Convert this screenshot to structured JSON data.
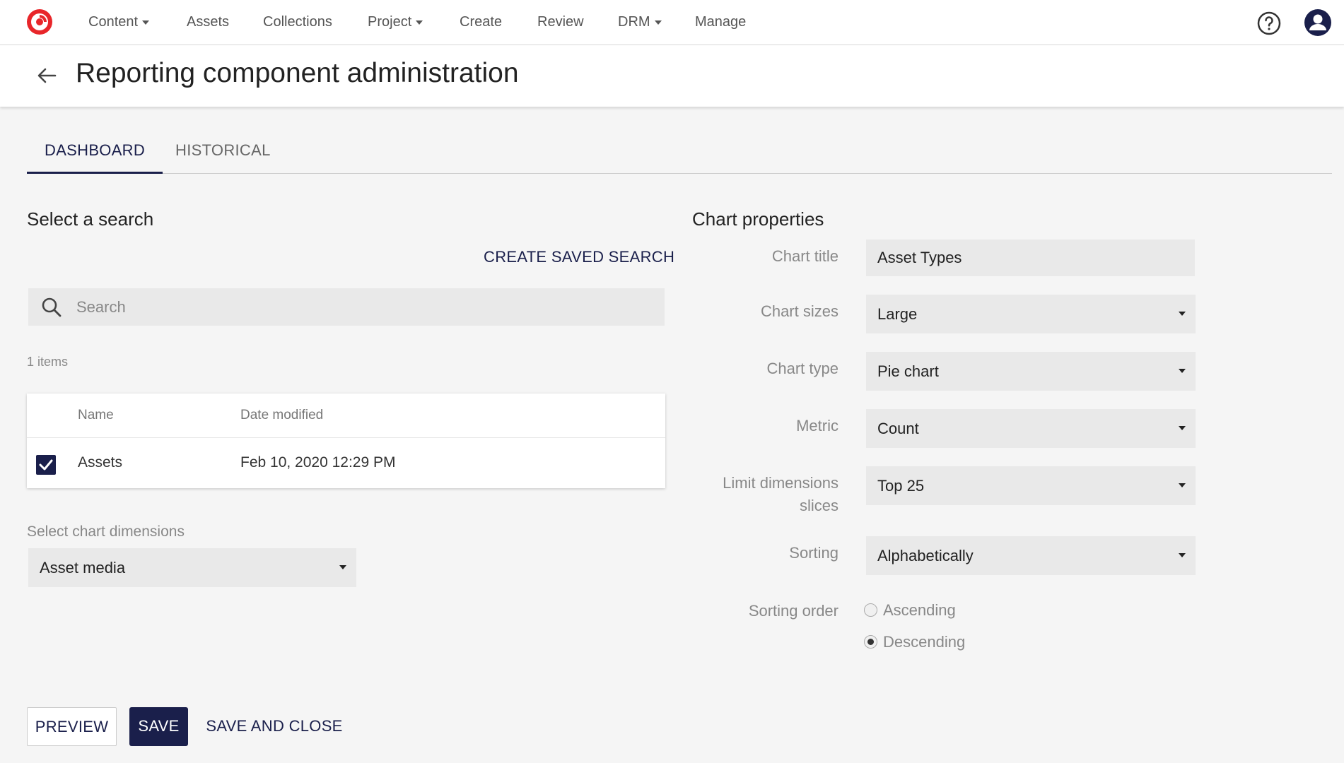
{
  "nav": {
    "items": [
      {
        "label": "Content",
        "dropdown": true
      },
      {
        "label": "Assets",
        "dropdown": false
      },
      {
        "label": "Collections",
        "dropdown": false
      },
      {
        "label": "Project",
        "dropdown": true
      },
      {
        "label": "Create",
        "dropdown": false
      },
      {
        "label": "Review",
        "dropdown": false
      },
      {
        "label": "DRM",
        "dropdown": true
      },
      {
        "label": "Manage",
        "dropdown": false
      }
    ],
    "icons": {
      "logo": "sitecore-logo-icon",
      "help": "help-circle-icon",
      "account": "user-avatar-icon"
    }
  },
  "header": {
    "title": "Reporting component administration"
  },
  "tabs": [
    {
      "label": "DASHBOARD",
      "active": true
    },
    {
      "label": "HISTORICAL",
      "active": false
    }
  ],
  "search_section": {
    "title": "Select a search",
    "create_link": "CREATE SAVED SEARCH",
    "search_placeholder": "Search",
    "search_value": "",
    "items_count": "1 items",
    "table": {
      "headers": {
        "name": "Name",
        "date": "Date modified"
      },
      "rows": [
        {
          "checked": true,
          "name": "Assets",
          "date": "Feb 10, 2020 12:29 PM"
        }
      ]
    },
    "dimensions_label": "Select chart dimensions",
    "dimensions_value": "Asset media"
  },
  "chart_properties": {
    "title": "Chart properties",
    "chart_title": {
      "label": "Chart title",
      "value": "Asset Types"
    },
    "chart_sizes": {
      "label": "Chart sizes",
      "value": "Large"
    },
    "chart_type": {
      "label": "Chart type",
      "value": "Pie chart"
    },
    "metric": {
      "label": "Metric",
      "value": "Count"
    },
    "limit": {
      "label": "Limit dimensions slices",
      "value": "Top 25"
    },
    "sorting": {
      "label": "Sorting",
      "value": "Alphabetically"
    },
    "sorting_order": {
      "label": "Sorting order",
      "options": [
        {
          "label": "Ascending",
          "checked": false
        },
        {
          "label": "Descending",
          "checked": true
        }
      ]
    }
  },
  "footer": {
    "preview": "PREVIEW",
    "save": "SAVE",
    "save_close": "SAVE AND CLOSE"
  },
  "colors": {
    "accent": "#1a1f4b",
    "logo": "#e8262a"
  }
}
